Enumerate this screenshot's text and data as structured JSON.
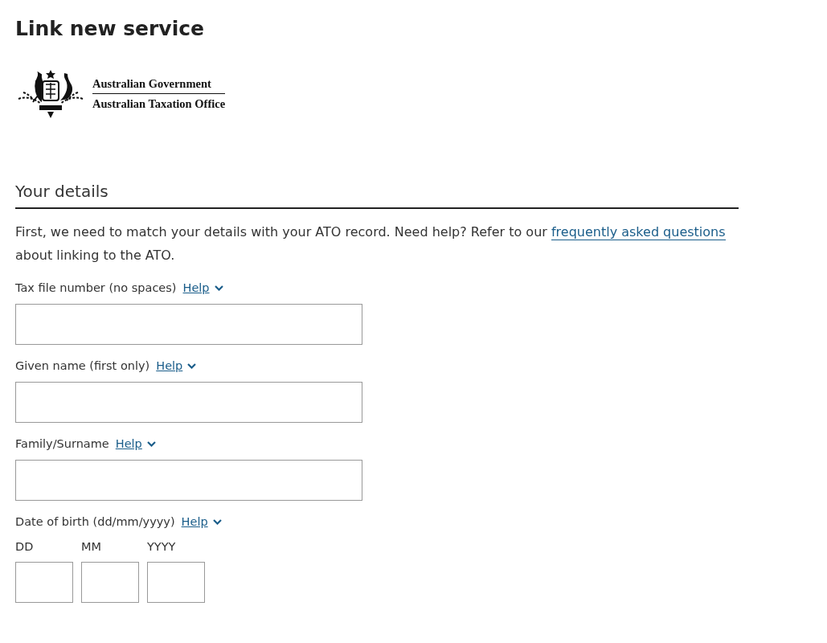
{
  "page_title": "Link new service",
  "logo": {
    "line_1": "Australian Government",
    "line_2": "Australian Taxation Office"
  },
  "section": {
    "heading": "Your details",
    "intro": {
      "before": "First, we need to match your details with your ATO record. Need help? Refer to our ",
      "link": "frequently asked questions",
      "after": " about linking to the ATO."
    }
  },
  "fields": [
    {
      "kind": "text",
      "label": "Tax file number (no spaces)",
      "help": "Help"
    },
    {
      "kind": "text",
      "label": "Given name (first only)",
      "help": "Help"
    },
    {
      "kind": "text",
      "label": "Family/Surname",
      "help": "Help"
    },
    {
      "kind": "date",
      "label": "Date of birth (dd/mm/yyyy)",
      "help": "Help",
      "parts": [
        "DD",
        "MM",
        "YYYY"
      ]
    }
  ]
}
